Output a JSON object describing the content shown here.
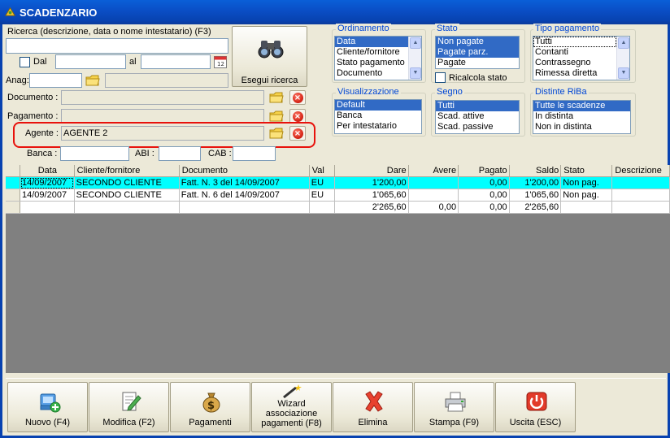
{
  "window": {
    "title": "SCADENZARIO"
  },
  "search": {
    "label": "Ricerca (descrizione, data o nome intestatario) (F3)",
    "value": "",
    "dal_label": "Dal",
    "al_label": "al",
    "anag_label": "Anag:",
    "button_label": "Esegui ricerca"
  },
  "filters": {
    "documento_label": "Documento :",
    "pagamento_label": "Pagamento :",
    "agente_label": "Agente :",
    "agente_value": "AGENTE 2",
    "banca_label": "Banca :",
    "abi_label": "ABI :",
    "cab_label": "CAB :"
  },
  "ordinamento": {
    "title": "Ordinamento",
    "items": [
      "Data",
      "Cliente/fornitore",
      "Stato pagamento",
      "Documento"
    ],
    "selected": 0
  },
  "stato": {
    "title": "Stato",
    "items": [
      "Non pagate",
      "Pagate parz.",
      "Pagate"
    ],
    "ricalcola_label": "Ricalcola stato"
  },
  "tipo_pagamento": {
    "title": "Tipo pagamento",
    "items": [
      "Tutti",
      "Contanti",
      "Contrassegno",
      "Rimessa diretta"
    ]
  },
  "visualizzazione": {
    "title": "Visualizzazione",
    "items": [
      "Default",
      "Banca",
      "Per intestatario"
    ]
  },
  "segno": {
    "title": "Segno",
    "items": [
      "Tutti",
      "Scad. attive",
      "Scad. passive"
    ]
  },
  "distinte": {
    "title": "Distinte RiBa",
    "items": [
      "Tutte le scadenze",
      "In distinta",
      "Non in distinta"
    ]
  },
  "grid": {
    "columns": [
      "Data",
      "Cliente/fornitore",
      "Documento",
      "Val",
      "Dare",
      "Avere",
      "Pagato",
      "Saldo",
      "Stato",
      "Descrizione"
    ],
    "rows": [
      [
        "14/09/2007",
        "SECONDO CLIENTE",
        "Fatt. N. 3 del 14/09/2007",
        "EU",
        "1'200,00",
        "",
        "0,00",
        "1'200,00",
        "Non pag.",
        ""
      ],
      [
        "14/09/2007",
        "SECONDO CLIENTE",
        "Fatt. N. 6 del 14/09/2007",
        "EU",
        "1'065,60",
        "",
        "0,00",
        "1'065,60",
        "Non pag.",
        ""
      ]
    ],
    "totals": [
      "",
      "",
      "",
      "",
      "2'265,60",
      "0,00",
      "0,00",
      "2'265,60",
      "",
      ""
    ]
  },
  "toolbar": {
    "nuovo": "Nuovo (F4)",
    "modifica": "Modifica (F2)",
    "pagamenti": "Pagamenti",
    "wizard_1": "Wizard",
    "wizard_2": "associazione",
    "wizard_3": "pagamenti (F8)",
    "elimina": "Elimina",
    "stampa": "Stampa (F9)",
    "uscita": "Uscita (ESC)"
  },
  "colors": {
    "selection": "#316ac5",
    "row_highlight": "#00ffff",
    "annotation": "#e8120c",
    "titlebar": "#0a4fc7"
  }
}
